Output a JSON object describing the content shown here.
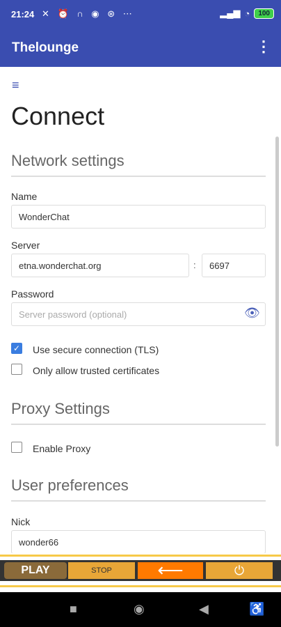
{
  "status": {
    "time": "21:24",
    "icons": "✕ ⏰ ∩ ◉ ⊛ ⋯",
    "signal": "▂▄▆",
    "wifi": "◔",
    "battery": "100"
  },
  "app": {
    "title": "Thelounge",
    "menu_icon": "⋮"
  },
  "page": {
    "menu_icon": "≡",
    "title": "Connect"
  },
  "network": {
    "section_title": "Network settings",
    "name_label": "Name",
    "name_value": "WonderChat",
    "server_label": "Server",
    "server_value": "etna.wonderchat.org",
    "colon": ":",
    "port_value": "6697",
    "password_label": "Password",
    "password_placeholder": "Server password (optional)",
    "tls_label": "Use secure connection (TLS)",
    "trusted_label": "Only allow trusted certificates"
  },
  "proxy": {
    "section_title": "Proxy Settings",
    "enable_label": "Enable Proxy"
  },
  "user": {
    "section_title": "User preferences",
    "nick_label": "Nick",
    "nick_value": "wonder66"
  },
  "ad": {
    "play": "PLAY",
    "stop": "STOP",
    "arrow": "⟵",
    "power": "⏻"
  },
  "nav": {
    "recent": "■",
    "home": "◉",
    "back": "◀",
    "accessibility": "♿"
  }
}
